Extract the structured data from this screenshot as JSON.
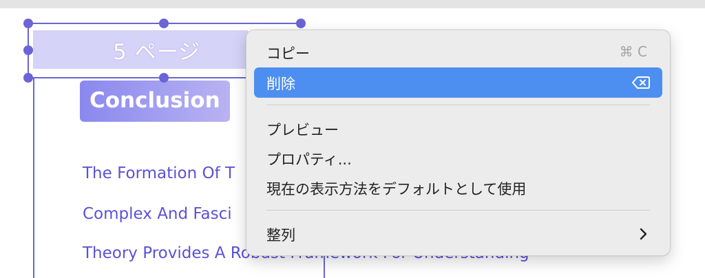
{
  "page": {
    "label": "5 ページ",
    "heading": "Conclusion",
    "toc": [
      "The Formation Of T",
      "Complex And Fasci",
      "Theory Provides A Robust Framework For Understanding"
    ]
  },
  "context_menu": {
    "items": [
      {
        "label": "コピー",
        "shortcut": "⌘ C"
      },
      {
        "label": "削除",
        "icon": "delete-backward-icon",
        "highlighted": true
      },
      {
        "label": "プレビュー"
      },
      {
        "label": "プロパティ..."
      },
      {
        "label": "現在の表示方法をデフォルトとして使用"
      },
      {
        "label": "整列",
        "icon": "chevron-right-icon"
      }
    ]
  },
  "colors": {
    "selection": "#6a64d6",
    "menu_highlight": "#4d8ff1",
    "menu_background": "#ececec",
    "toc_text": "#5a52d6"
  }
}
